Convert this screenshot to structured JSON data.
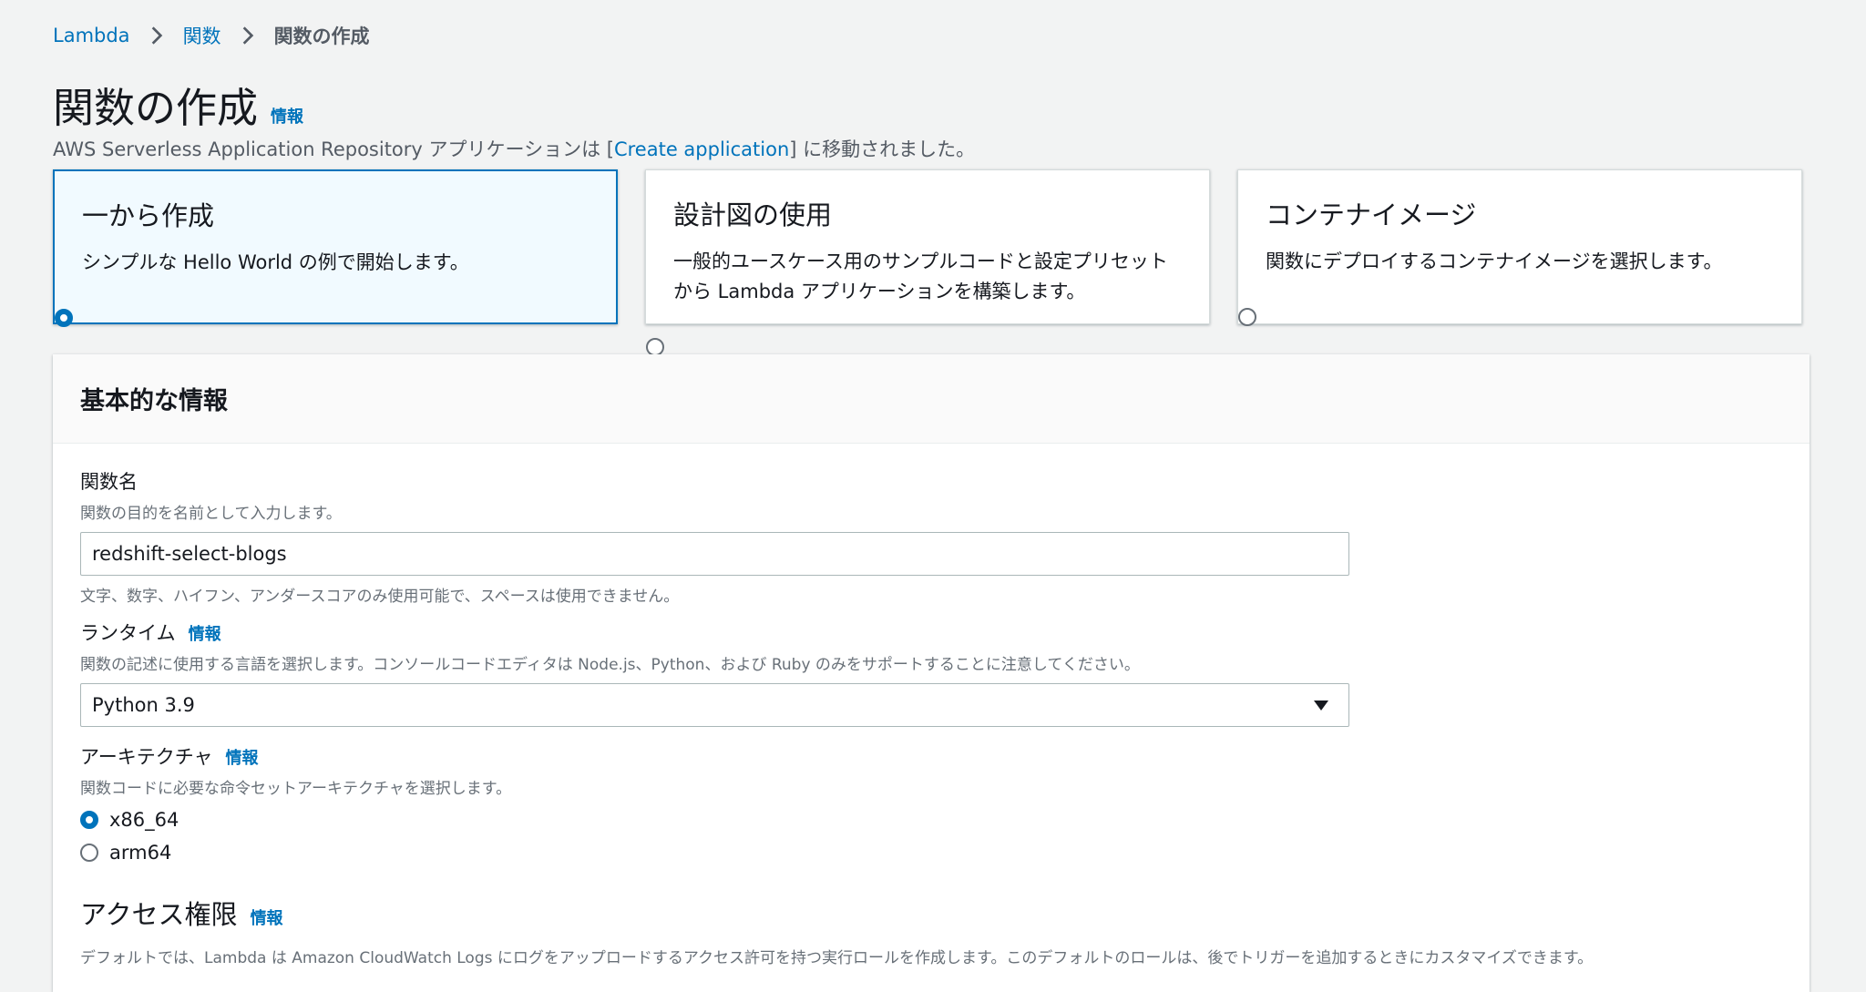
{
  "breadcrumb": {
    "items": [
      "Lambda",
      "関数"
    ],
    "current": "関数の作成"
  },
  "page": {
    "title": "関数の作成",
    "info_link": "情報",
    "notice_prefix": "AWS Serverless Application Repository アプリケーションは [",
    "notice_link": "Create application",
    "notice_suffix": "] に移動されました。"
  },
  "options": [
    {
      "title": "一から作成",
      "desc": "シンプルな Hello World の例で開始します。",
      "selected": true
    },
    {
      "title": "設計図の使用",
      "desc": "一般的ユースケース用のサンプルコードと設定プリセットから Lambda アプリケーションを構築します。",
      "selected": false
    },
    {
      "title": "コンテナイメージ",
      "desc": "関数にデプロイするコンテナイメージを選択します。",
      "selected": false
    }
  ],
  "basic": {
    "header": "基本的な情報",
    "function_name": {
      "label": "関数名",
      "desc": "関数の目的を名前として入力します。",
      "value": "redshift-select-blogs",
      "constraint": "文字、数字、ハイフン、アンダースコアのみ使用可能で、スペースは使用できません。"
    },
    "runtime": {
      "label": "ランタイム",
      "info": "情報",
      "desc": "関数の記述に使用する言語を選択します。コンソールコードエディタは Node.js、Python、および Ruby のみをサポートすることに注意してください。",
      "value": "Python 3.9"
    },
    "architecture": {
      "label": "アーキテクチャ",
      "info": "情報",
      "desc": "関数コードに必要な命令セットアーキテクチャを選択します。",
      "options": [
        {
          "label": "x86_64",
          "checked": true
        },
        {
          "label": "arm64",
          "checked": false
        }
      ]
    },
    "permissions": {
      "title": "アクセス権限",
      "info": "情報",
      "desc": "デフォルトでは、Lambda は Amazon CloudWatch Logs にログをアップロードするアクセス許可を持つ実行ロールを作成します。このデフォルトのロールは、後でトリガーを追加するときにカスタマイズできます。"
    }
  },
  "colors": {
    "link": "#0073bb",
    "selected_bg": "#f1faff",
    "page_bg": "#f2f3f3"
  }
}
